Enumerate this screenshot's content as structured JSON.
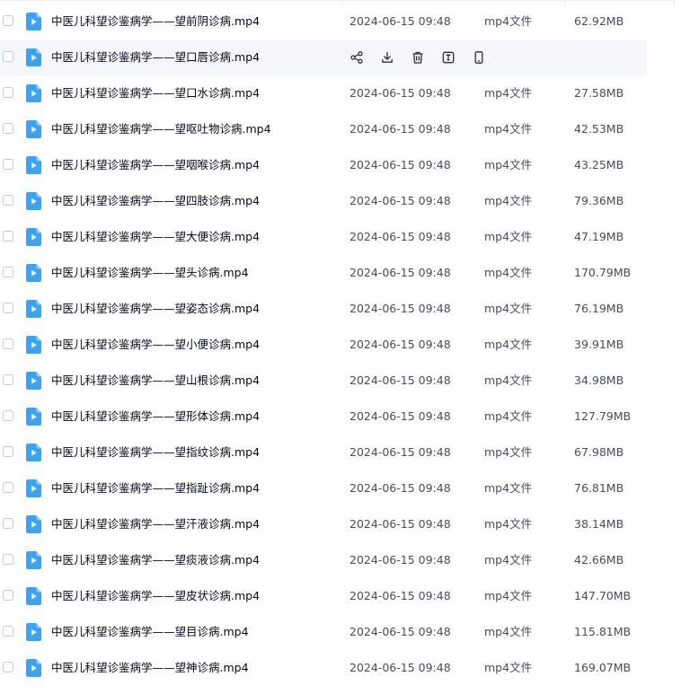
{
  "file_icon_color": "#3aa3f5",
  "hover_actions": [
    {
      "icon": "share-icon"
    },
    {
      "icon": "download-icon"
    },
    {
      "icon": "trash-icon"
    },
    {
      "icon": "text-recognize-icon"
    },
    {
      "icon": "phone-send-icon"
    }
  ],
  "files": [
    {
      "name": "中医儿科望诊鉴病学——望前阴诊病.mp4",
      "date": "2024-06-15 09:48",
      "type": "mp4文件",
      "size": "62.92MB",
      "hovered": false
    },
    {
      "name": "中医儿科望诊鉴病学——望口唇诊病.mp4",
      "date": "",
      "type": "",
      "size": "",
      "hovered": true
    },
    {
      "name": "中医儿科望诊鉴病学——望口水诊病.mp4",
      "date": "2024-06-15 09:48",
      "type": "mp4文件",
      "size": "27.58MB",
      "hovered": false
    },
    {
      "name": "中医儿科望诊鉴病学——望呕吐物诊病.mp4",
      "date": "2024-06-15 09:48",
      "type": "mp4文件",
      "size": "42.53MB",
      "hovered": false
    },
    {
      "name": "中医儿科望诊鉴病学——望咽喉诊病.mp4",
      "date": "2024-06-15 09:48",
      "type": "mp4文件",
      "size": "43.25MB",
      "hovered": false
    },
    {
      "name": "中医儿科望诊鉴病学——望四肢诊病.mp4",
      "date": "2024-06-15 09:48",
      "type": "mp4文件",
      "size": "79.36MB",
      "hovered": false
    },
    {
      "name": "中医儿科望诊鉴病学——望大便诊病.mp4",
      "date": "2024-06-15 09:48",
      "type": "mp4文件",
      "size": "47.19MB",
      "hovered": false
    },
    {
      "name": "中医儿科望诊鉴病学——望头诊病.mp4",
      "date": "2024-06-15 09:48",
      "type": "mp4文件",
      "size": "170.79MB",
      "hovered": false
    },
    {
      "name": "中医儿科望诊鉴病学——望姿态诊病.mp4",
      "date": "2024-06-15 09:48",
      "type": "mp4文件",
      "size": "76.19MB",
      "hovered": false
    },
    {
      "name": "中医儿科望诊鉴病学——望小便诊病.mp4",
      "date": "2024-06-15 09:48",
      "type": "mp4文件",
      "size": "39.91MB",
      "hovered": false
    },
    {
      "name": "中医儿科望诊鉴病学——望山根诊病.mp4",
      "date": "2024-06-15 09:48",
      "type": "mp4文件",
      "size": "34.98MB",
      "hovered": false
    },
    {
      "name": "中医儿科望诊鉴病学——望形体诊病.mp4",
      "date": "2024-06-15 09:48",
      "type": "mp4文件",
      "size": "127.79MB",
      "hovered": false
    },
    {
      "name": "中医儿科望诊鉴病学——望指纹诊病.mp4",
      "date": "2024-06-15 09:48",
      "type": "mp4文件",
      "size": "67.98MB",
      "hovered": false
    },
    {
      "name": "中医儿科望诊鉴病学——望指趾诊病.mp4",
      "date": "2024-06-15 09:48",
      "type": "mp4文件",
      "size": "76.81MB",
      "hovered": false
    },
    {
      "name": "中医儿科望诊鉴病学——望汗液诊病.mp4",
      "date": "2024-06-15 09:48",
      "type": "mp4文件",
      "size": "38.14MB",
      "hovered": false
    },
    {
      "name": "中医儿科望诊鉴病学——望痰液诊病.mp4",
      "date": "2024-06-15 09:48",
      "type": "mp4文件",
      "size": "42.66MB",
      "hovered": false
    },
    {
      "name": "中医儿科望诊鉴病学——望皮状诊病.mp4",
      "date": "2024-06-15 09:48",
      "type": "mp4文件",
      "size": "147.70MB",
      "hovered": false
    },
    {
      "name": "中医儿科望诊鉴病学——望目诊病.mp4",
      "date": "2024-06-15 09:48",
      "type": "mp4文件",
      "size": "115.81MB",
      "hovered": false
    },
    {
      "name": "中医儿科望诊鉴病学——望神诊病.mp4",
      "date": "2024-06-15 09:48",
      "type": "mp4文件",
      "size": "169.07MB",
      "hovered": false
    }
  ]
}
